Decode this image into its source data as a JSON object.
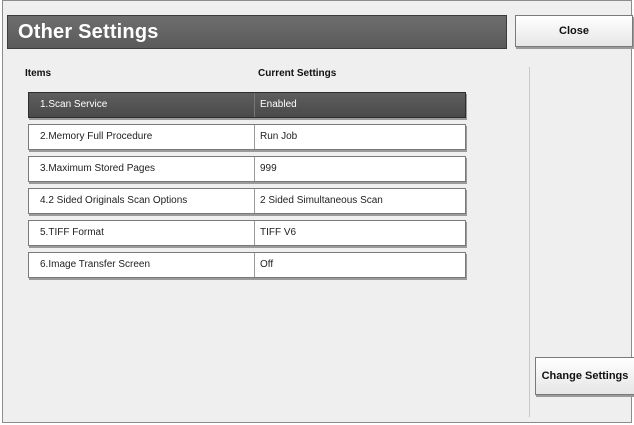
{
  "header": {
    "title": "Other Settings",
    "close_label": "Close"
  },
  "columns": {
    "items": "Items",
    "current": "Current Settings"
  },
  "settings": [
    {
      "item": "1.Scan Service",
      "value": "Enabled",
      "selected": true
    },
    {
      "item": "2.Memory Full Procedure",
      "value": "Run Job",
      "selected": false
    },
    {
      "item": "3.Maximum Stored Pages",
      "value": "999",
      "selected": false
    },
    {
      "item": "4.2 Sided Originals Scan Options",
      "value": "2 Sided Simultaneous Scan",
      "selected": false
    },
    {
      "item": "5.TIFF Format",
      "value": "TIFF V6",
      "selected": false
    },
    {
      "item": "6.Image Transfer Screen",
      "value": "Off",
      "selected": false
    }
  ],
  "footer": {
    "change_label": "Change Settings"
  },
  "colors": {
    "title_bar": "#5f5f5f",
    "selected_row": "#545454",
    "panel_background": "#efefef"
  }
}
